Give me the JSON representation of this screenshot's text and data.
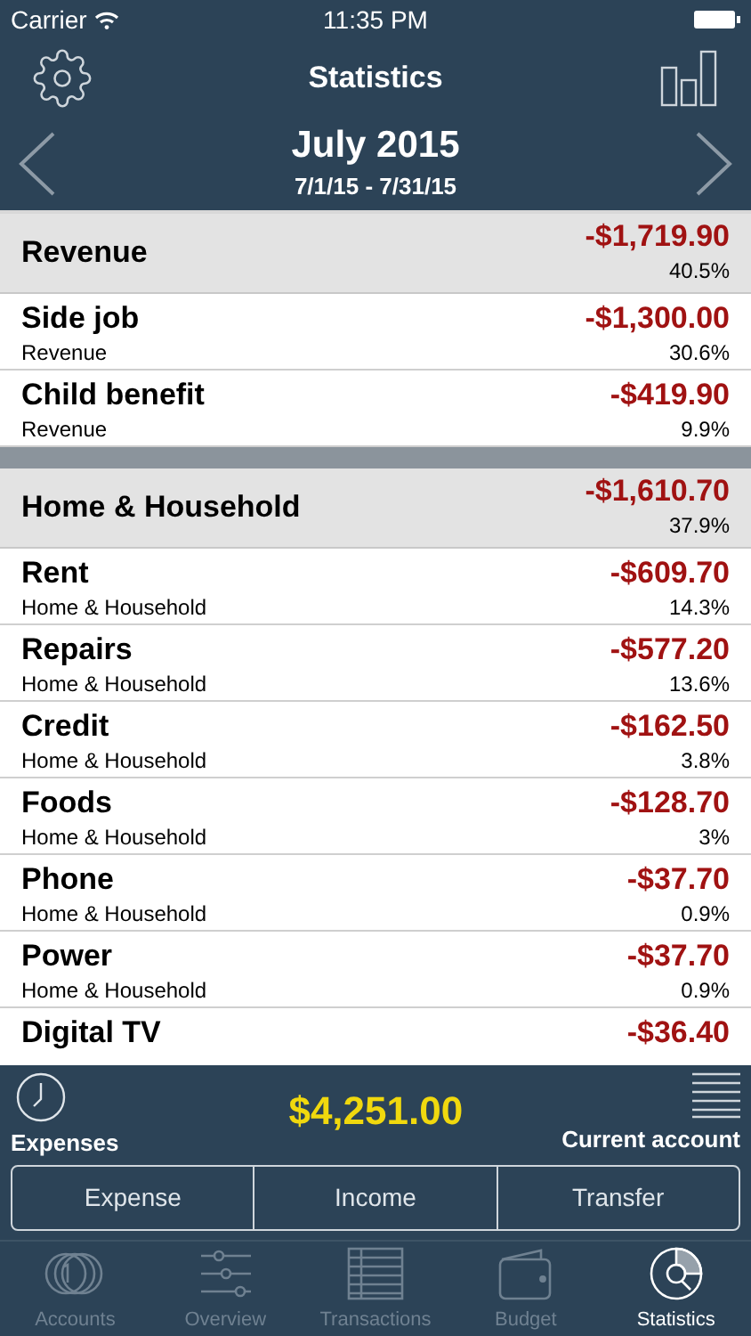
{
  "status_bar": {
    "carrier": "Carrier",
    "time": "11:35 PM"
  },
  "nav": {
    "title": "Statistics"
  },
  "period": {
    "title": "July 2015",
    "range": "7/1/15 - 7/31/15"
  },
  "groups": [
    {
      "name": "Revenue",
      "amount": "-$1,719.90",
      "percent": "40.5%",
      "items": [
        {
          "name": "Side job",
          "category": "Revenue",
          "amount": "-$1,300.00",
          "percent": "30.6%"
        },
        {
          "name": "Child benefit",
          "category": "Revenue",
          "amount": "-$419.90",
          "percent": "9.9%"
        }
      ]
    },
    {
      "name": "Home & Household",
      "amount": "-$1,610.70",
      "percent": "37.9%",
      "items": [
        {
          "name": "Rent",
          "category": "Home & Household",
          "amount": "-$609.70",
          "percent": "14.3%"
        },
        {
          "name": "Repairs",
          "category": "Home & Household",
          "amount": "-$577.20",
          "percent": "13.6%"
        },
        {
          "name": "Credit",
          "category": "Home & Household",
          "amount": "-$162.50",
          "percent": "3.8%"
        },
        {
          "name": "Foods",
          "category": "Home & Household",
          "amount": "-$128.70",
          "percent": "3%"
        },
        {
          "name": "Phone",
          "category": "Home & Household",
          "amount": "-$37.70",
          "percent": "0.9%"
        },
        {
          "name": "Power",
          "category": "Home & Household",
          "amount": "-$37.70",
          "percent": "0.9%"
        },
        {
          "name": "Digital TV",
          "amount": "-$36.40"
        }
      ]
    }
  ],
  "summary": {
    "left_label": "Expenses",
    "total": "$4,251.00",
    "right_label": "Current account"
  },
  "actions": [
    {
      "label": "Expense"
    },
    {
      "label": "Income"
    },
    {
      "label": "Transfer"
    }
  ],
  "tabs": [
    {
      "label": "Accounts",
      "kind": "coins",
      "selected": false
    },
    {
      "label": "Overview",
      "kind": "sliders",
      "selected": false
    },
    {
      "label": "Transactions",
      "kind": "table",
      "selected": false
    },
    {
      "label": "Budget",
      "kind": "wallet",
      "selected": false
    },
    {
      "label": "Statistics",
      "kind": "pie",
      "selected": true
    }
  ]
}
